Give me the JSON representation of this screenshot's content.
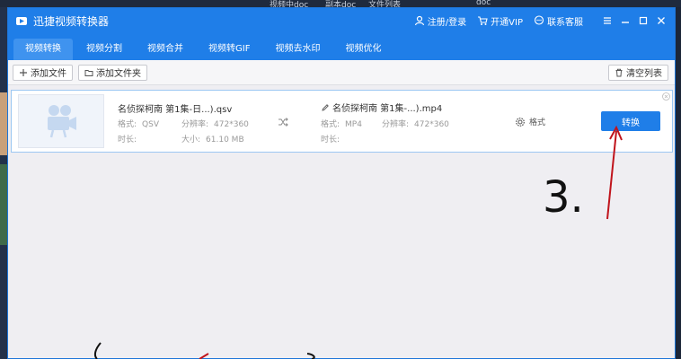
{
  "desktop": {
    "tray_labels": [
      "视频中doc",
      "副本doc",
      "文件列表",
      "doc"
    ]
  },
  "app": {
    "title": "迅捷视频转换器",
    "login_label": "注册/登录",
    "vip_label": "开通VIP",
    "support_label": "联系客服"
  },
  "tabs": [
    {
      "label": "视频转换"
    },
    {
      "label": "视频分割"
    },
    {
      "label": "视频合并"
    },
    {
      "label": "视频转GIF"
    },
    {
      "label": "视频去水印"
    },
    {
      "label": "视频优化"
    }
  ],
  "toolbar": {
    "add_file": "添加文件",
    "add_folder": "添加文件夹",
    "clear_list": "清空列表"
  },
  "item": {
    "source_name": "名侦探柯南 第1集-日...).qsv",
    "format_label": "格式:",
    "source_format": "QSV",
    "resolution_label": "分辨率:",
    "source_resolution": "472*360",
    "duration_label": "时长:",
    "source_duration": "",
    "size_label": "大小:",
    "source_size": "61.10 MB",
    "target_name": "名侦探柯南 第1集-...).mp4",
    "target_format": "MP4",
    "target_resolution": "472*360",
    "target_duration": "",
    "format_setting_label": "格式",
    "convert_label": "转换"
  },
  "annotation": {
    "step_label": "3."
  },
  "colors": {
    "brand_blue": "#1f7ee8",
    "annotation_red": "#c0141c"
  }
}
